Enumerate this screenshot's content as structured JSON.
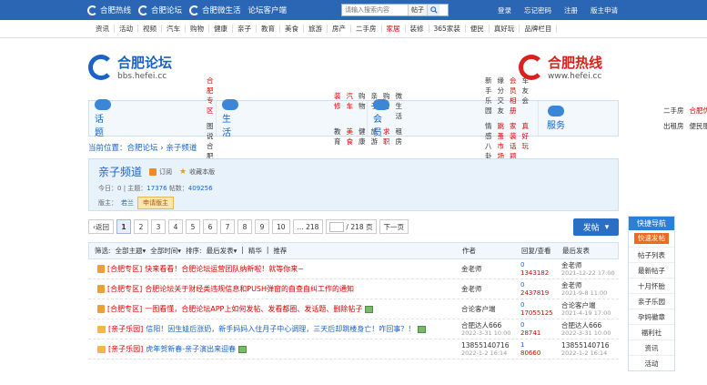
{
  "topbar": {
    "links": [
      "合肥热线",
      "合肥论坛",
      "合肥微生活",
      "论坛客户端"
    ],
    "search_placeholder": "请输入搜索内容",
    "search_scope": "帖子",
    "right": [
      "登录",
      "忘记密码",
      "注册",
      "版主申请"
    ]
  },
  "nav": [
    "资讯",
    "活动",
    "视频",
    "汽车",
    "购物",
    "健康",
    "亲子",
    "教育",
    "美食",
    "旅游",
    "房产",
    "二手房",
    "家居",
    "装修",
    "365家装",
    "便民",
    "真好玩",
    "品牌栏目"
  ],
  "logos": {
    "left_title": "合肥论坛",
    "left_url": "bbs.hefei.cc",
    "right_title": "合肥热线",
    "right_url": "www.hefei.cc"
  },
  "cats": [
    {
      "label": "话题",
      "rows": [
        [
          "合肥专区"
        ],
        [
          "图说合肥"
        ]
      ]
    },
    {
      "label": "生活",
      "rows": [
        [
          "装修",
          "汽车",
          "购物",
          "亲子",
          "购房",
          "微生活"
        ],
        [
          "教育",
          "美食",
          "健康",
          "旅游",
          "求职",
          "租房"
        ]
      ]
    },
    {
      "label": "会员",
      "rows": [
        [
          "新手乐园",
          "缘分交友",
          "会员相册",
          "车友会"
        ],
        [
          "情感八卦",
          "跳蚤市场",
          "家装话题",
          "真好玩"
        ]
      ]
    },
    {
      "label": "服务",
      "rows": [
        [
          "二手房",
          "合肥优选"
        ],
        [
          "出租房",
          "便民服务"
        ]
      ]
    }
  ],
  "breadcrumb": {
    "prefix": "当前位置：",
    "home": "合肥论坛",
    "sep": " › ",
    "current": "亲子频道"
  },
  "channel": {
    "title": "亲子频道",
    "subscribe": "订阅",
    "favorite": "收藏本版",
    "today_label": "今日：",
    "today": "0",
    "topics_label": "主题：",
    "topics": "17376",
    "posts_label": "帖数：",
    "posts": "409256",
    "mod_label": "版主：",
    "mod": "若兰",
    "apply": "申请版主"
  },
  "pager": {
    "prev": "返回",
    "pages": [
      "1",
      "2",
      "3",
      "4",
      "5",
      "6",
      "7",
      "8",
      "9",
      "10",
      "... 218"
    ],
    "current": "1",
    "total": "/ 218 页",
    "next": "下一页",
    "post": "发帖"
  },
  "thead": {
    "filter": "筛选:",
    "all_topics": "全部主题",
    "all_time": "全部时间",
    "sort": "排序:",
    "sort_val": "最后发表",
    "digest": "精华",
    "recommend": "推荐",
    "author": "作者",
    "reply": "回复/查看",
    "last": "最后发表"
  },
  "threads": [
    {
      "cat": "[合肥专区]",
      "title": "快来看看！合肥论坛运营团队纳新啦！就等你来~",
      "author": "金老师",
      "date": "",
      "replies": "0",
      "views": "1343182",
      "last": "金老师",
      "last_date": "2021-12-22 17:00",
      "type": "lock"
    },
    {
      "cat": "[合肥专区]",
      "title": "合肥论坛关于财经类违规信息和PUSH弹窗的自查自纠工作的通知",
      "author": "金老师",
      "date": "",
      "replies": "0",
      "views": "2437819",
      "last": "金老师",
      "last_date": "2021-9-8 11:00",
      "type": "lock"
    },
    {
      "cat": "[合肥专区]",
      "title": "一图看懂，合肥论坛APP上如何发帖、发看都圈、发话题、删除帖子",
      "author": "合论客户端",
      "date": "",
      "replies": "0",
      "views": "17055125",
      "last": "合论客户端",
      "last_date": "2021-4-19 17:00",
      "type": "lock"
    },
    {
      "cat": "[亲子乐园]",
      "title": "信阳！因生娃后涨奶，新手妈妈入住月子中心调理，三天后却跳楼身亡！咋回事？！",
      "author": "合肥达人666",
      "date": "2022-3-31 10:00",
      "replies": "0",
      "views": "28741",
      "last": "合肥达人666",
      "last_date": "2022-3-31 10:00",
      "type": "fold"
    },
    {
      "cat": "[亲子乐园]",
      "title": "虎年贺新春-亲子演出来迎春",
      "author": "13855140716",
      "date": "2022-1-2 16:14",
      "replies": "1",
      "views": "80660",
      "last": "13855140716",
      "last_date": "2022-1-2 16:14",
      "type": "fold"
    }
  ],
  "sidebar": {
    "title": "快捷导航",
    "quick": "快速发帖",
    "items": [
      "帖子列表",
      "最新帖子",
      "十月怀胎",
      "亲子乐园",
      "孕妈徽章",
      "福利社",
      "资讯",
      "活动"
    ]
  }
}
